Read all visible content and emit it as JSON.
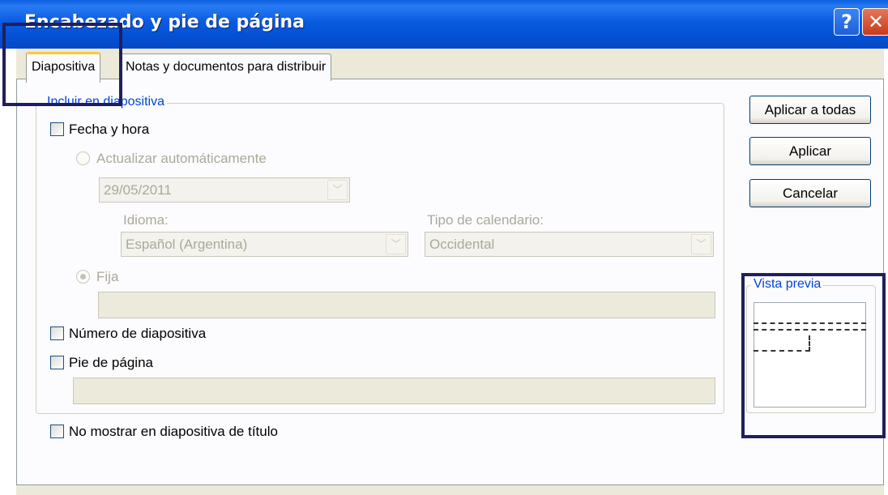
{
  "window": {
    "title": "Encabezado y pie de página",
    "help_glyph": "?",
    "close_glyph": "✕"
  },
  "tabs": [
    {
      "label": "Diapositiva",
      "active": true
    },
    {
      "label": "Notas y documentos para distribuir",
      "active": false
    }
  ],
  "group": {
    "legend": "Incluir en diapositiva",
    "fecha_hora": {
      "label": "Fecha y hora",
      "checked": false
    },
    "actualizar": {
      "label": "Actualizar automáticamente",
      "checked": false,
      "disabled": true
    },
    "date_value": "29/05/2011",
    "idioma_label": "Idioma:",
    "idioma_value": "Español (Argentina)",
    "calendario_label": "Tipo de calendario:",
    "calendario_value": "Occidental",
    "fija": {
      "label": "Fija",
      "checked": true,
      "disabled": true
    },
    "fija_value": "",
    "numero": {
      "label": "Número de diapositiva",
      "checked": false
    },
    "pie": {
      "label": "Pie de página",
      "checked": false
    },
    "pie_value": ""
  },
  "no_mostrar": {
    "label": "No mostrar en diapositiva de título",
    "checked": false
  },
  "buttons": {
    "aplicar_todas": "Aplicar a todas",
    "aplicar": "Aplicar",
    "cancelar": "Cancelar"
  },
  "preview": {
    "legend": "Vista previa"
  },
  "colors": {
    "title_bar": "#0a5be0",
    "accent": "#0046d5",
    "highlight": "#1f1f5e"
  }
}
